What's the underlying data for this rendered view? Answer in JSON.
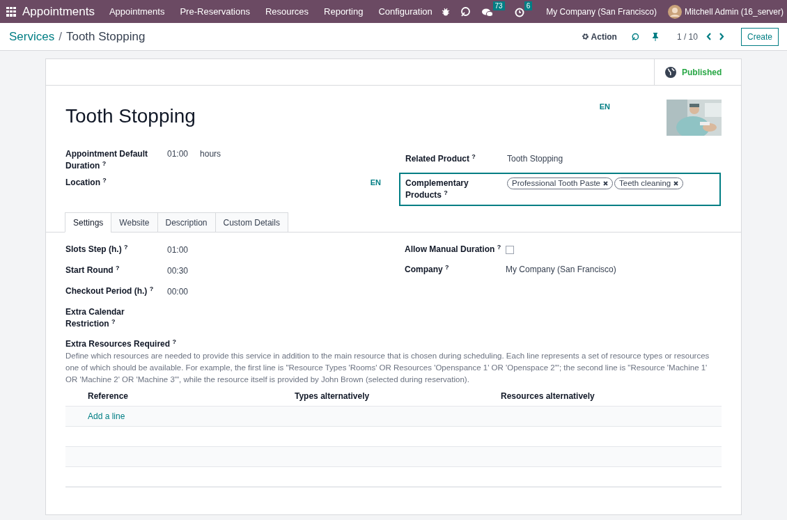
{
  "navbar": {
    "app_name": "Appointments",
    "menu": [
      "Appointments",
      "Pre-Reservations",
      "Resources",
      "Reporting",
      "Configuration"
    ],
    "messages_count": "73",
    "activities_count": "6",
    "company": "My Company (San Francisco)",
    "user": "Mitchell Admin (16_server)"
  },
  "breadcrumb": [
    "Services",
    "Tooth Stopping"
  ],
  "breadcrumb_separator": "/",
  "control_panel": {
    "action": "Action",
    "pager": "1 / 10",
    "create": "Create"
  },
  "form": {
    "status": "Published",
    "name": "Tooth Stopping",
    "name_lang": "EN",
    "fields_left": [
      {
        "label": "Appointment Default Duration $^{?}$",
        "value": "01:00",
        "unit": "hours"
      },
      {
        "label": "Location $^{?}$",
        "lang": "EN"
      }
    ],
    "fields_right": [
      {
        "kind": "text",
        "label": "Related Product $^{?}$",
        "value": "Tooth Stopping",
        "focused": false
      },
      {
        "kind": "tags",
        "label": "Complementary Products $^{?}$",
        "tags": [
          "Professional Tooth Paste",
          "Teeth cleaning"
        ],
        "focused": true
      }
    ]
  },
  "tabs": [
    {
      "label": "Settings",
      "selected": true
    },
    {
      "label": "Website",
      "selected": false
    },
    {
      "label": "Description",
      "selected": false
    },
    {
      "label": "Custom Details",
      "selected": false
    }
  ],
  "settings": {
    "left": [
      {
        "label": "Slots Step (h.) $^{?}$",
        "value": "01:00"
      },
      {
        "label": "Start Round $^{?}$",
        "value": "00:30"
      },
      {
        "label": "Checkout Period (h.) $^{?}$",
        "value": "00:00"
      },
      {
        "label": "Extra Calendar Restriction $^{?}$"
      }
    ],
    "right": [
      {
        "kind": "checkbox",
        "label": "Allow Manual Duration $^{?}$",
        "checked": false
      },
      {
        "kind": "text",
        "label": "Company $^{?}$",
        "value": "My Company (San Francisco)"
      }
    ],
    "extra_resources": {
      "label": "Extra Resources Required $^{?}$",
      "help": "Define which resources are needed to provide this service in addition to the main resource that is chosen during scheduling. Each line represents a set of resource types or resources one of which should be available. For example, the first line is \"Resource Types 'Rooms' OR Resources 'Openspance 1' OR 'Openspace 2'\"; the second line is \"Resource 'Machine 1' OR 'Machine 2' OR 'Machine 3'\", while the resource itself is provided by John Brown (selected during reservation).",
      "columns": [
        "Reference",
        "Types alternatively",
        "Resources alternatively"
      ],
      "add_line": "Add a line"
    }
  }
}
